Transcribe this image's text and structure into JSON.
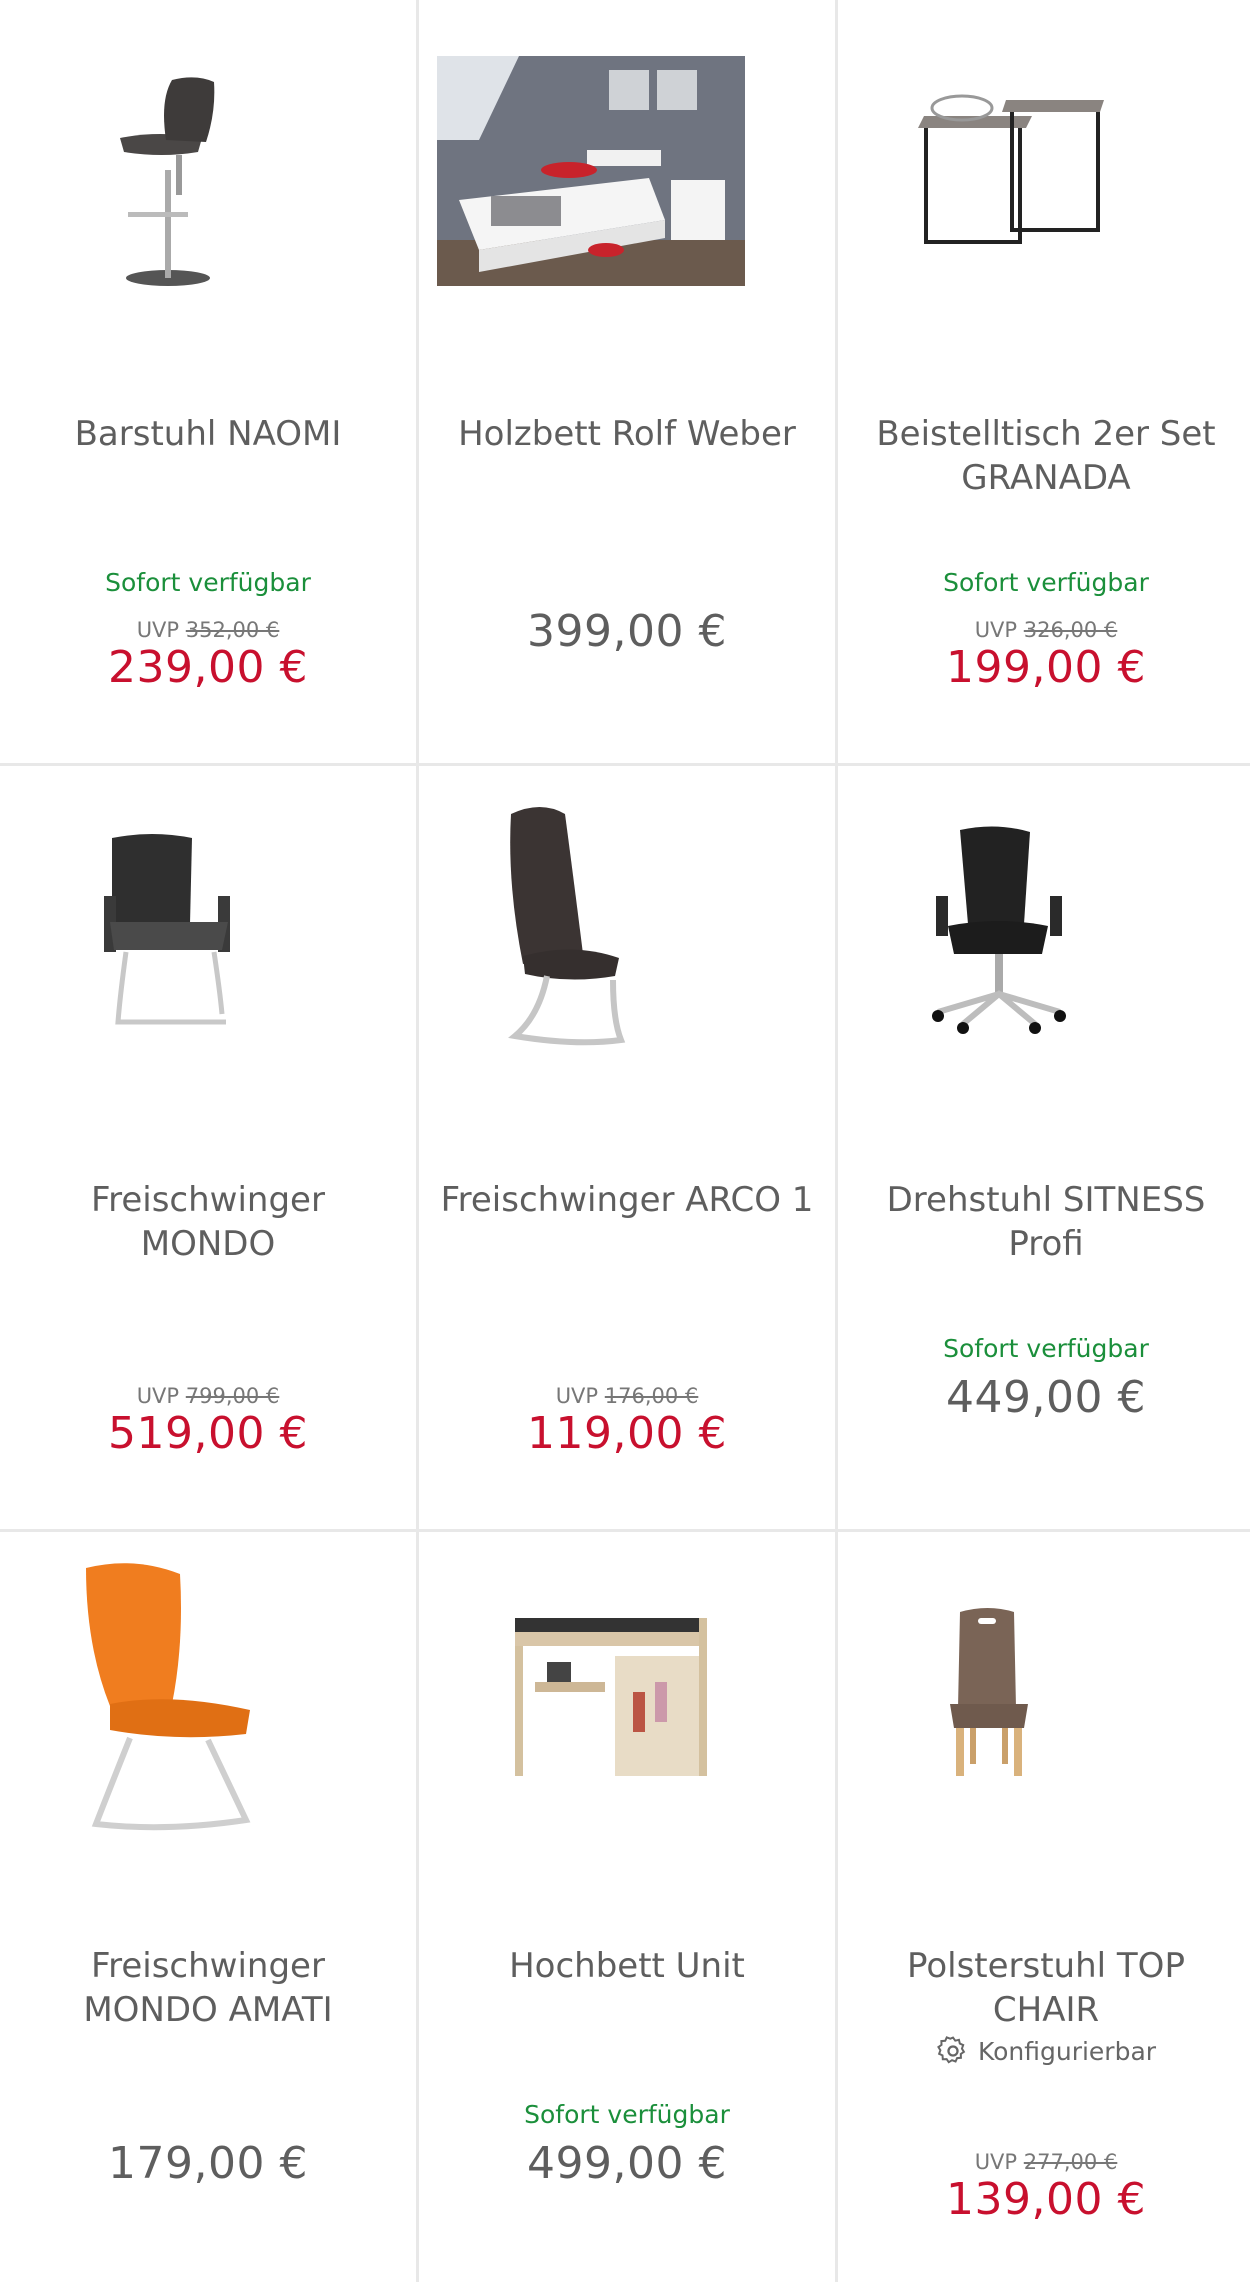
{
  "products": [
    {
      "title": "Barstuhl NAOMI",
      "availability": "Sofort verfügbar",
      "uvp_label": "UVP",
      "uvp_price": "352,00 €",
      "price": "239,00 €",
      "image": "bar-stool-image"
    },
    {
      "title": "Holzbett Rolf Weber",
      "price": "399,00 €",
      "image": "wooden-bed-image"
    },
    {
      "title": "Beistelltisch 2er Set GRANADA",
      "availability": "Sofort verfügbar",
      "uvp_label": "UVP",
      "uvp_price": "326,00 €",
      "price": "199,00 €",
      "image": "side-tables-image"
    },
    {
      "title": "Freischwinger MONDO",
      "uvp_label": "UVP",
      "uvp_price": "799,00 €",
      "price": "519,00 €",
      "image": "cantilever-armchair-image"
    },
    {
      "title": "Freischwinger ARCO 1",
      "uvp_label": "UVP",
      "uvp_price": "176,00 €",
      "price": "119,00 €",
      "image": "cantilever-chair-image"
    },
    {
      "title": "Drehstuhl SITNESS Profi",
      "availability": "Sofort verfügbar",
      "price": "449,00 €",
      "image": "office-chair-image"
    },
    {
      "title": "Freischwinger MONDO AMATI",
      "price": "179,00 €",
      "image": "orange-chair-image"
    },
    {
      "title": "Hochbett Unit",
      "availability": "Sofort verfügbar",
      "price": "499,00 €",
      "image": "loft-bed-image"
    },
    {
      "title": "Polsterstuhl TOP CHAIR",
      "config": "Konfigurierbar",
      "uvp_label": "UVP",
      "uvp_price": "277,00 €",
      "price": "139,00 €",
      "image": "upholstered-chair-image"
    }
  ],
  "colors": {
    "sale_price": "#c8102e",
    "normal_price": "#5e5e5e",
    "availability": "#1b8f3b",
    "divider": "#e8e8e8"
  }
}
